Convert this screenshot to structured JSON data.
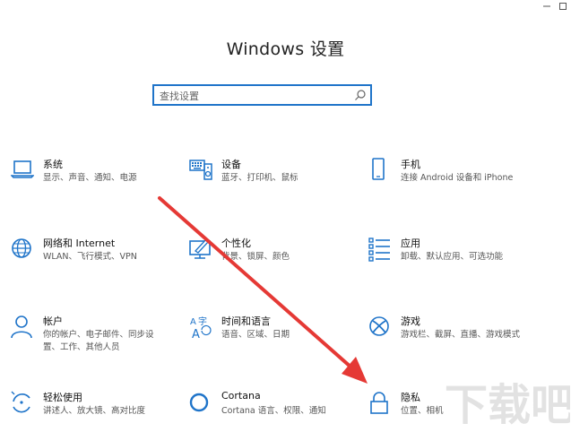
{
  "window": {
    "title": "Windows 设置",
    "controls": [
      "minimize-icon",
      "maximize-icon"
    ]
  },
  "search": {
    "placeholder": "查找设置",
    "icon": "search-icon"
  },
  "tiles": [
    {
      "id": "system",
      "name": "系统",
      "desc": "显示、声音、通知、电源",
      "icon": "laptop-icon"
    },
    {
      "id": "devices",
      "name": "设备",
      "desc": "蓝牙、打印机、鼠标",
      "icon": "keyboard-speaker-icon"
    },
    {
      "id": "phone",
      "name": "手机",
      "desc": "连接 Android 设备和 iPhone",
      "icon": "phone-icon"
    },
    {
      "id": "network",
      "name": "网络和 Internet",
      "desc": "WLAN、飞行模式、VPN",
      "icon": "globe-icon"
    },
    {
      "id": "personalization",
      "name": "个性化",
      "desc": "背景、锁屏、颜色",
      "icon": "paint-monitor-icon"
    },
    {
      "id": "apps",
      "name": "应用",
      "desc": "卸载、默认应用、可选功能",
      "icon": "apps-list-icon"
    },
    {
      "id": "accounts",
      "name": "帐户",
      "desc": "你的帐户、电子邮件、同步设置、工作、其他人员",
      "icon": "person-icon"
    },
    {
      "id": "time",
      "name": "时间和语言",
      "desc": "语音、区域、日期",
      "icon": "language-clock-icon"
    },
    {
      "id": "gaming",
      "name": "游戏",
      "desc": "游戏栏、截屏、直播、游戏模式",
      "icon": "xbox-icon"
    },
    {
      "id": "ease",
      "name": "轻松使用",
      "desc": "讲述人、放大镜、高对比度",
      "icon": "ease-of-access-icon"
    },
    {
      "id": "cortana",
      "name": "Cortana",
      "desc": "Cortana 语言、权限、通知",
      "icon": "cortana-circle-icon"
    },
    {
      "id": "privacy",
      "name": "隐私",
      "desc": "位置、相机",
      "icon": "lock-icon"
    }
  ],
  "annotation": {
    "icon": "red-arrow-icon",
    "color": "#e53935"
  },
  "watermark": {
    "text": "下载吧",
    "icon": "watermark-logo"
  },
  "colors": {
    "accent": "#1f74c9",
    "arrow": "#e53935"
  }
}
